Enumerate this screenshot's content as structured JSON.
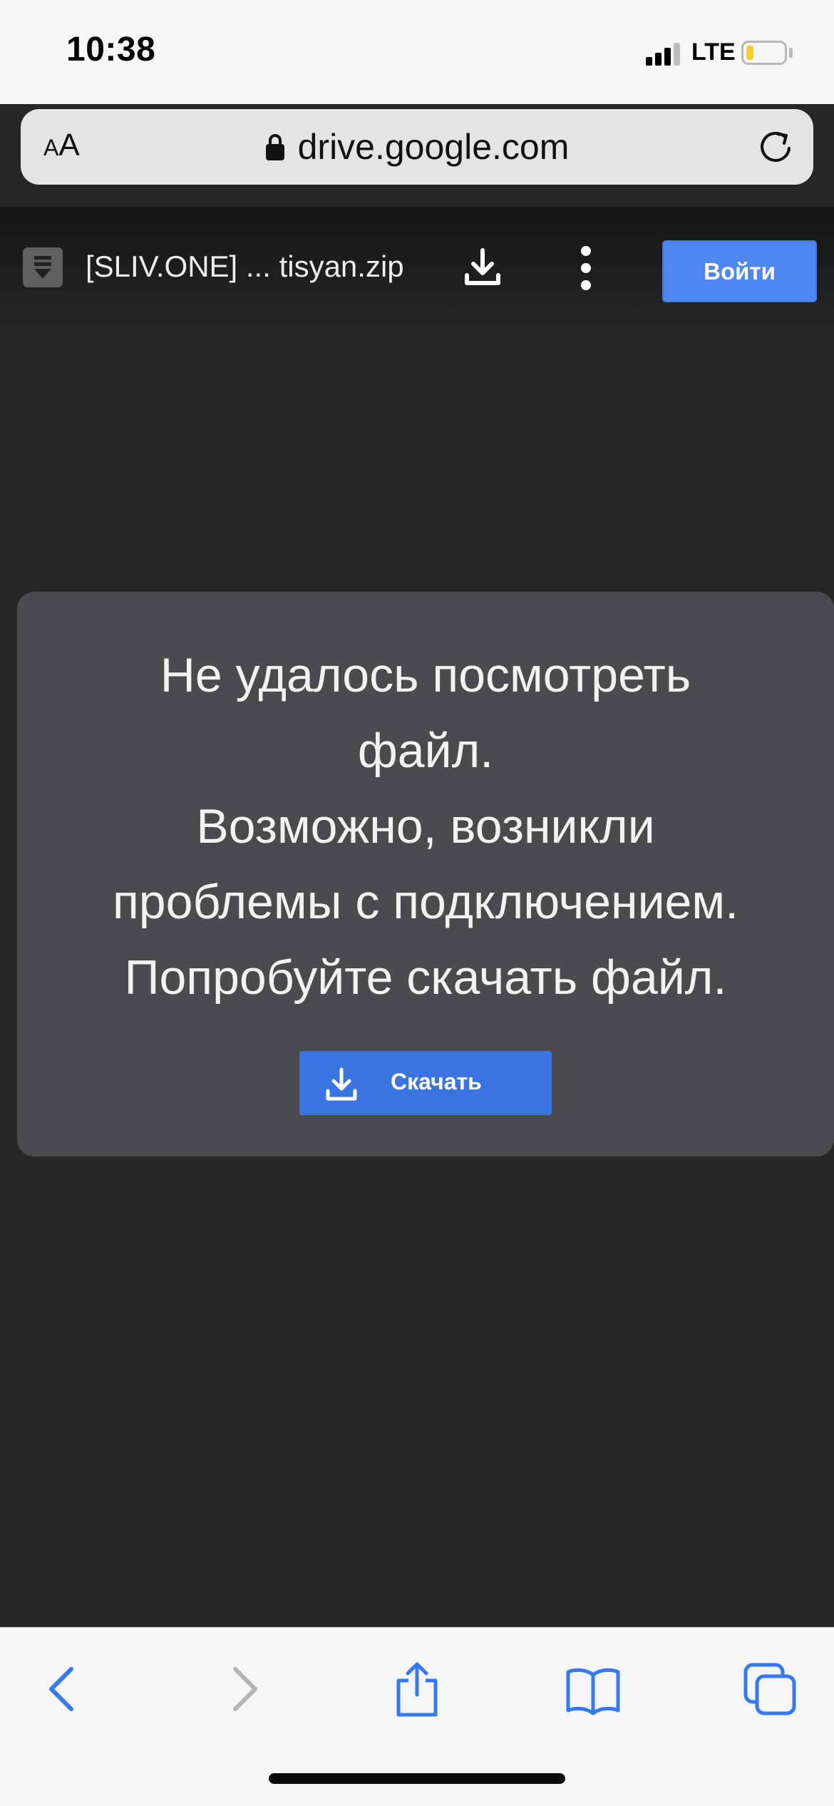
{
  "status_bar": {
    "time": "10:38",
    "network": "LTE",
    "battery_level": 0.2,
    "battery_color": "#f6cf2f"
  },
  "address_bar": {
    "text_size_small": "A",
    "text_size_large": "A",
    "url": "drive.google.com",
    "icons": [
      "lock-icon",
      "reload-icon"
    ]
  },
  "viewer_header": {
    "file_icon": "archive-file-icon",
    "file_name": "[SLIV.ONE] ... tisyan.zip",
    "download_icon": "download-icon",
    "more_icon": "more-vertical-icon",
    "login_label": "Войти",
    "accent_color": "#4f86f1"
  },
  "error_card": {
    "message_lines": [
      "Не удалось посмотреть",
      "файл.",
      "Возможно, возникли",
      "проблемы с подключением.",
      "Попробуйте скачать файл."
    ],
    "download_label": "Скачать",
    "download_icon": "download-icon",
    "button_color": "#3a74e0"
  },
  "bottom_toolbar": {
    "items": [
      "back-icon",
      "forward-icon",
      "share-icon",
      "bookmarks-icon",
      "tabs-icon"
    ],
    "active_color": "#3478f6",
    "disabled_color": "#b4b4b8"
  }
}
